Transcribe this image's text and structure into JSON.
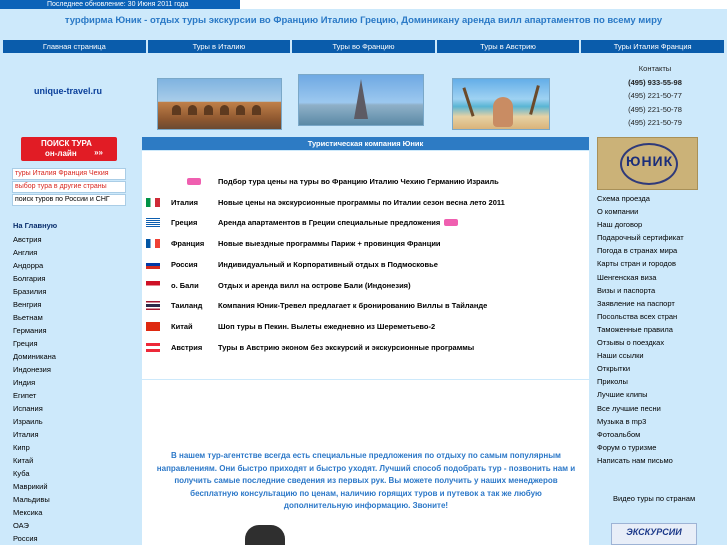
{
  "top": {
    "updated": "Последнее обновление: 30 Июня 2011 года",
    "headline": "турфирма Юник - отдых туры экскурсии во Францию Италию Грецию, Доминикану аренда вилл апартаментов по всему миру"
  },
  "nav": [
    "Главная страница",
    "Туры в Италию",
    "Туры во Францию",
    "Туры в Австрию",
    "Туры Италия Франция"
  ],
  "header": {
    "site_name": "unique-travel.ru"
  },
  "contacts": {
    "title": "Контакты",
    "phones": [
      "(495) 933-55-98",
      "(495) 221-50-77",
      "(495) 221-50-78",
      "(495) 221-50-79"
    ]
  },
  "left": {
    "search_button": {
      "line1": "ПОИСК ТУРА",
      "line2": "он-лайн",
      "arrows": "»»"
    },
    "links": [
      "туры Италия Франция Чехия",
      "выбор тура в другие страны",
      "поиск туров по России и СНГ"
    ],
    "home": "На Главную",
    "countries": [
      "Австрия",
      "Англия",
      "Андорра",
      "Болгария",
      "Бразилия",
      "Венгрия",
      "Вьетнам",
      "Германия",
      "Греция",
      "Доминикана",
      "Индонезия",
      "Индия",
      "Египет",
      "Испания",
      "Израиль",
      "Италия",
      "Кипр",
      "Китай",
      "Куба",
      "Маврикий",
      "Мальдивы",
      "Мексика",
      "ОАЭ",
      "Россия"
    ]
  },
  "main": {
    "box_title": "Туристическая компания Юник",
    "offers": [
      {
        "country": "",
        "desc": "Подбор тура цены на туры во Францию Италию Чехию Германию Израиль",
        "badge": "new"
      },
      {
        "country": "Италия",
        "desc": "Новые цены на экскурсионные программы по Италии сезон весна лето 2011",
        "badge": ""
      },
      {
        "country": "Греция",
        "desc": "Аренда апартаментов в Греции специальные предложения",
        "badge": "new"
      },
      {
        "country": "Франция",
        "desc": "Новые выездные программы Париж + провинция Франции",
        "badge": ""
      },
      {
        "country": "Россия",
        "desc": "Индивидуальный и Корпоративный отдых в Подмосковье",
        "badge": ""
      },
      {
        "country": "о. Бали",
        "desc": "Отдых и аренда вилл на острове Бали (Индонезия)",
        "badge": ""
      },
      {
        "country": "Таиланд",
        "desc": "Компания Юник-Тревел предлагает к бронированию Виллы в Тайланде",
        "badge": ""
      },
      {
        "country": "Китай",
        "desc": "Шоп туры в Пекин. Вылеты ежедневно из Шереметьево-2",
        "badge": ""
      },
      {
        "country": "Австрия",
        "desc": "Туры в Австрию эконом без экскурсий и экскурсионные программы",
        "badge": ""
      }
    ],
    "intro": "В нашем тур-агентстве всегда есть специальные предложения по отдыху по самым популярным направлениям. Они быстро приходят и быстро уходят. Лучший способ подобрать тур - позвонить нам и получить самые последние сведения из первых рук. Вы можете получить у наших менеджеров бесплатную консультацию по ценам, наличию горящих туров и путевок а так же любую дополнительную информацию. Звоните!"
  },
  "right": {
    "logo_text": "ЮНИК",
    "links": [
      "Схема проезда",
      "О компании",
      "Наш договор",
      "Подарочный сертификат",
      "Погода в странах мира",
      "Карты стран и городов",
      "Шенгенская виза",
      "Визы и паспорта",
      "Заявление на паспорт",
      "Посольства всех стран",
      "Таможенные правила",
      "Отзывы о поездках",
      "Наши ссылки",
      "Открытки",
      "Приколы",
      "Лучшие клипы",
      "Все лучшие песни",
      "Музыка в mp3",
      "Фотоальбом",
      "Форум о туризме",
      "Написать нам письмо"
    ],
    "video_label": "Видео туры по странам",
    "excursions_label": "ЭКСКУРСИИ"
  },
  "colors": {
    "page_bg": "#cde9fb",
    "nav_bg": "#0a5cab",
    "box_header": "#2d7bc4",
    "red_button": "#e11c25",
    "intro_text": "#2c78c8"
  }
}
